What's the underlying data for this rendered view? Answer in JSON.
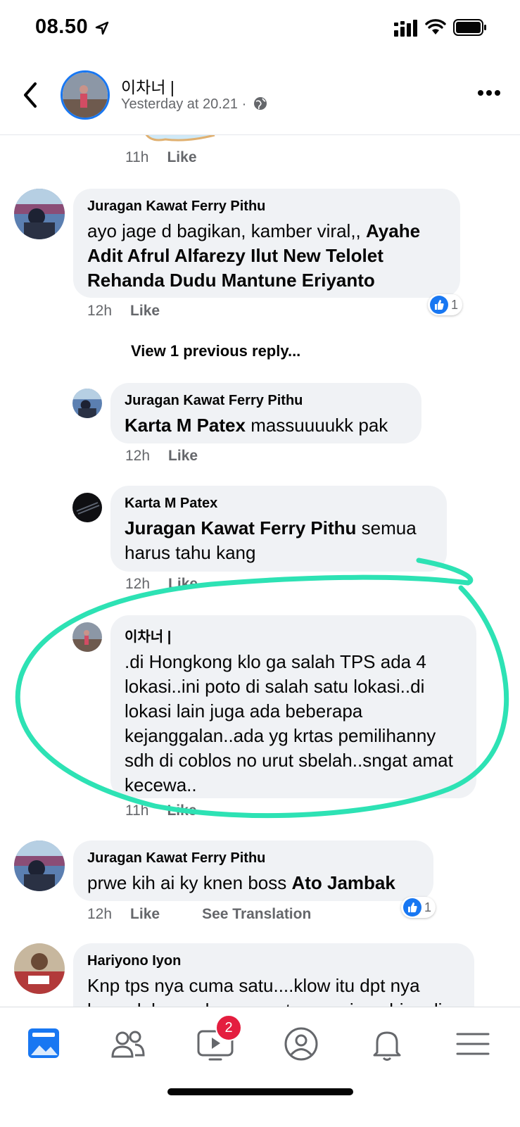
{
  "status_bar": {
    "time": "08.50"
  },
  "post_header": {
    "author": "이차너 |",
    "timestamp": "Yesterday at 20.21 ·"
  },
  "top_comment_meta": {
    "time": "11h",
    "like": "Like"
  },
  "comments": [
    {
      "author": "Juragan Kawat Ferry Pithu",
      "text_plain": "ayo jage d bagikan, kamber viral,, ",
      "text_bold": "Ayahe Adit Afrul Alfarezy Ilut New Telolet Rehanda Dudu Mantune Eriyanto",
      "time": "12h",
      "like": "Like",
      "reaction_count": "1"
    }
  ],
  "view_previous": "View 1 previous reply...",
  "replies": [
    {
      "author": "Juragan Kawat Ferry Pithu",
      "mention": "Karta M Patex",
      "text": " massuuuukk pak",
      "time": "12h",
      "like": "Like"
    },
    {
      "author": "Karta M Patex",
      "mention": "Juragan Kawat Ferry Pithu",
      "text": " semua harus tahu kang",
      "time": "12h",
      "like": "Like"
    },
    {
      "author": "이차너 |",
      "text": ".di Hongkong klo ga salah TPS ada 4 lokasi..ini poto di salah satu lokasi..di lokasi lain juga ada beberapa kejanggalan..ada yg krtas pemilihanny sdh di coblos no urut sbelah..sngat amat kecewa..",
      "time": "11h",
      "like": "Like"
    }
  ],
  "comment2": {
    "author": "Juragan Kawat Ferry Pithu",
    "text_plain": "prwe kih ai ky knen boss ",
    "text_bold": "Ato Jambak",
    "time": "12h",
    "like": "Like",
    "translate": "See Translation",
    "reaction_count": "1"
  },
  "comment3": {
    "author": "Hariyono Iyon",
    "text": "Knp tps nya cuma satu....klow itu dpt nya banyak knp seharusnya tps nya juga bisa di"
  },
  "tabbar": {
    "video_badge": "2"
  },
  "colors": {
    "accent": "#1877f2",
    "bubble": "#f0f2f5",
    "highlight": "#2de2b4",
    "badge": "#e41e3f"
  }
}
